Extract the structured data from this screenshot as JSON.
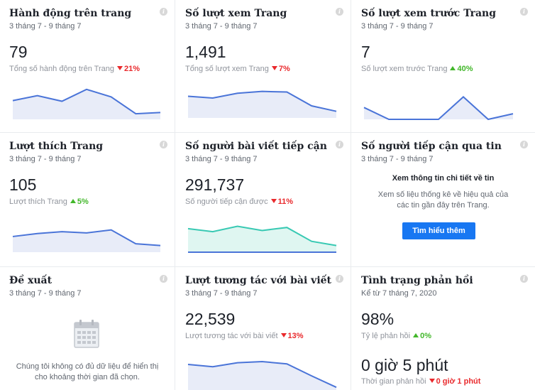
{
  "colors": {
    "line_blue": "#4a74d8",
    "area_fill": "#e8ecf8",
    "teal": "#38c9b3",
    "down": "#e9292c",
    "up": "#42b72a",
    "button": "#1877f2"
  },
  "cards": {
    "page_actions": {
      "title": "Hành động trên trang",
      "date": "3 tháng 7 - 9 tháng 7",
      "value": "79",
      "sublabel": "Tổng số hành động trên Trang",
      "change": "21%",
      "trend": "down",
      "spark": [
        36,
        28,
        37,
        18,
        30,
        57,
        55
      ]
    },
    "page_views": {
      "title": "Số lượt xem Trang",
      "date": "3 tháng 7 - 9 tháng 7",
      "value": "1,491",
      "sublabel": "Tổng số lượt xem Trang",
      "change": "7%",
      "trend": "down",
      "spark": [
        30,
        33,
        25,
        22,
        23,
        46,
        55
      ]
    },
    "page_previews": {
      "title": "Số lượt xem trước Trang",
      "date": "3 tháng 7 - 9 tháng 7",
      "value": "7",
      "sublabel": "Số lượt xem trước Trang",
      "change": "40%",
      "trend": "up",
      "spark": [
        47,
        66,
        66,
        66,
        30,
        66,
        57
      ]
    },
    "page_likes": {
      "title": "Lượt thích Trang",
      "date": "3 tháng 7 - 9 tháng 7",
      "value": "105",
      "sublabel": "Lượt thích Trang",
      "change": "5%",
      "trend": "up",
      "spark": [
        40,
        35,
        32,
        34,
        29,
        52,
        55
      ]
    },
    "post_reach": {
      "title": "Số người bài viết tiếp cận",
      "date": "3 tháng 7 - 9 tháng 7",
      "value": "291,737",
      "sublabel": "Số người tiếp cận được",
      "change": "11%",
      "trend": "down",
      "spark": [
        27,
        32,
        23,
        30,
        25,
        48,
        55
      ]
    },
    "story_reach": {
      "title": "Số người tiếp cận qua tin",
      "date": "3 tháng 7 - 9 tháng 7",
      "heading": "Xem thông tin chi tiết về tin",
      "text": "Xem số liệu thống kê về hiệu quả của các tin gần đây trên Trang.",
      "button": "Tìm hiểu thêm"
    },
    "recommendations": {
      "title": "Đề xuất",
      "date": "3 tháng 7 - 9 tháng 7",
      "no_data": "Chúng tôi không có đủ dữ liệu để hiển thị cho khoảng thời gian đã chọn.",
      "icon": "calendar-icon"
    },
    "post_engagement": {
      "title": "Lượt tương tác với bài viết",
      "date": "3 tháng 7 - 9 tháng 7",
      "value": "22,539",
      "sublabel": "Lượt tương tác với bài viết",
      "change": "13%",
      "trend": "down",
      "spark": [
        15,
        19,
        12,
        10,
        14,
        35,
        55
      ]
    },
    "response_status": {
      "title": "Tình trạng phản hồi",
      "date": "Kể từ 7 tháng 7, 2020",
      "value": "98%",
      "sublabel": "Tỷ lệ phản hồi",
      "change": "0%",
      "trend": "up",
      "value2": "0 giờ 5 phút",
      "sublabel2": "Thời gian phản hồi",
      "change2": "0 giờ 1 phút",
      "trend2": "down"
    }
  }
}
